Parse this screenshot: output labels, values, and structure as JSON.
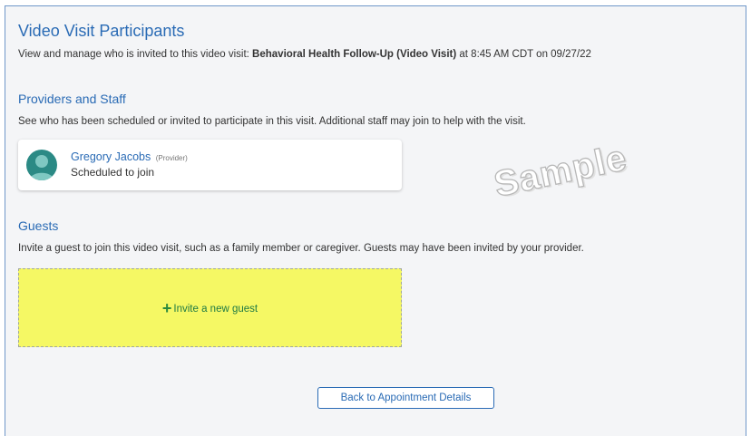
{
  "header": {
    "title": "Video Visit Participants",
    "subtitle_prefix": "View and manage who is invited to this video visit: ",
    "visit_name": "Behavioral Health Follow-Up (Video Visit)",
    "subtitle_suffix": " at 8:45 AM CDT on 09/27/22"
  },
  "providers": {
    "heading": "Providers and Staff",
    "description": "See who has been scheduled or invited to participate in this visit. Additional staff may join to help with the visit.",
    "items": [
      {
        "name": "Gregory Jacobs",
        "role": "(Provider)",
        "status": "Scheduled to join",
        "avatar_icon": "person-silhouette-icon",
        "avatar_color": "#2b8a85"
      }
    ]
  },
  "watermark": "Sample",
  "guests": {
    "heading": "Guests",
    "description": "Invite a guest to join this video visit, such as a family member or caregiver. Guests may have been invited by your provider.",
    "invite_icon": "plus-icon",
    "invite_symbol": "+",
    "invite_label": "Invite a new guest",
    "invite_bg": "#f5f864"
  },
  "footer": {
    "back_label": "Back to Appointment Details"
  },
  "colors": {
    "accent": "#2a6bb5",
    "panel_bg": "#f4f5f7",
    "invite_text": "#1f7a44"
  }
}
